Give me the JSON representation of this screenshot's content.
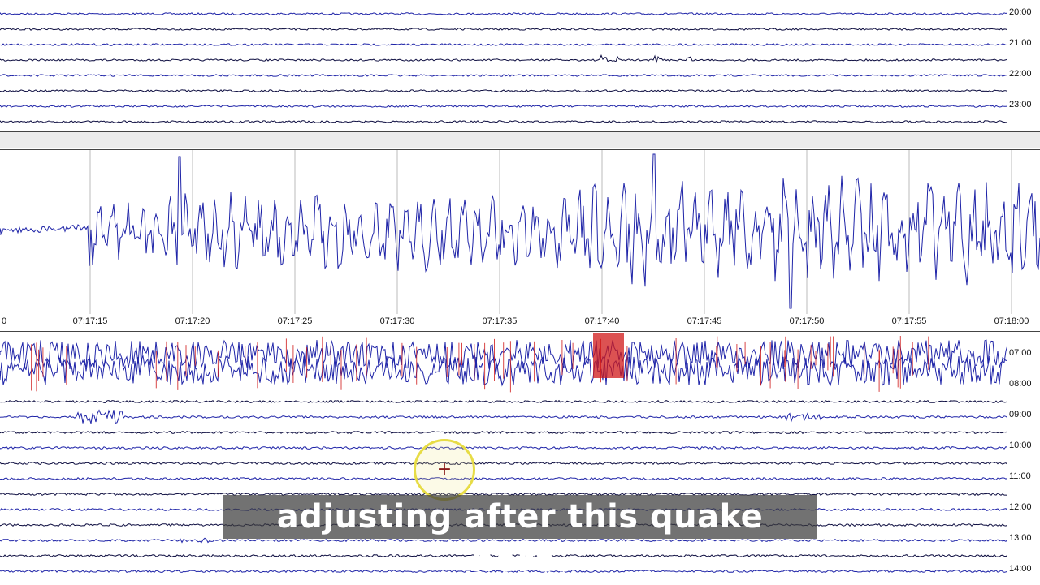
{
  "top_helicorder": {
    "hour_labels": [
      "20:00",
      "21:00",
      "22:00",
      "23:00"
    ]
  },
  "zoom_view": {
    "time_ticks": [
      "0",
      "07:17:15",
      "07:17:20",
      "07:17:25",
      "07:17:30",
      "07:17:35",
      "07:17:40",
      "07:17:45",
      "07:17:50",
      "07:17:55",
      "07:18:00"
    ]
  },
  "bottom_helicorder": {
    "hour_labels": [
      "07:00",
      "08:00",
      "09:00",
      "10:00",
      "11:00",
      "12:00",
      "13:00",
      "14:00"
    ]
  },
  "caption": {
    "text": "adjusting after this quake here."
  },
  "colors": {
    "trace": "#1f24a8",
    "trace_dark": "#0d0d40",
    "highlight_red": "#d01818",
    "cursor_ring": "#e7dc46"
  }
}
